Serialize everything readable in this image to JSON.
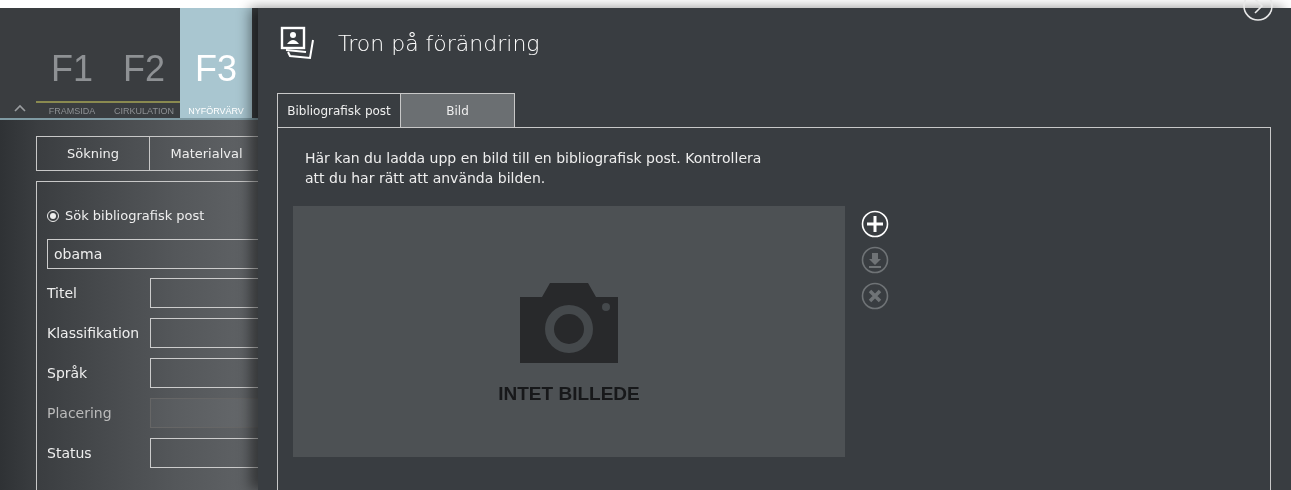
{
  "nav_tabs": [
    {
      "key": "F1",
      "label": "FRAMSIDA",
      "selected": false
    },
    {
      "key": "F2",
      "label": "CIRKULATION",
      "selected": false
    },
    {
      "key": "F3",
      "label": "NYFÖRVÄRV",
      "selected": true
    }
  ],
  "mode_buttons": [
    {
      "label": "Sökning"
    },
    {
      "label": "Materialval"
    }
  ],
  "search_option": {
    "label": "Sök bibliografisk post",
    "selected": true
  },
  "search_field": {
    "value": "obama"
  },
  "fields": [
    {
      "label": "Titel",
      "disabled": false
    },
    {
      "label": "Klassifikation",
      "disabled": false
    },
    {
      "label": "Språk",
      "disabled": false
    },
    {
      "label": "Placering",
      "disabled": true
    },
    {
      "label": "Status",
      "disabled": false
    }
  ],
  "record": {
    "title": "Tron på förändring",
    "tabs": [
      {
        "label": "Bibliografisk post",
        "selected": false
      },
      {
        "label": "Bild",
        "selected": true
      }
    ],
    "description": "Här kan du ladda upp en bild till en bibliografisk post. Kontrollera att du har rätt att använda bilden.",
    "image_placeholder": "INTET BILLEDE",
    "actions": [
      {
        "kind": "add",
        "disabled": false
      },
      {
        "kind": "download",
        "disabled": true
      },
      {
        "kind": "delete",
        "disabled": true
      }
    ]
  }
}
